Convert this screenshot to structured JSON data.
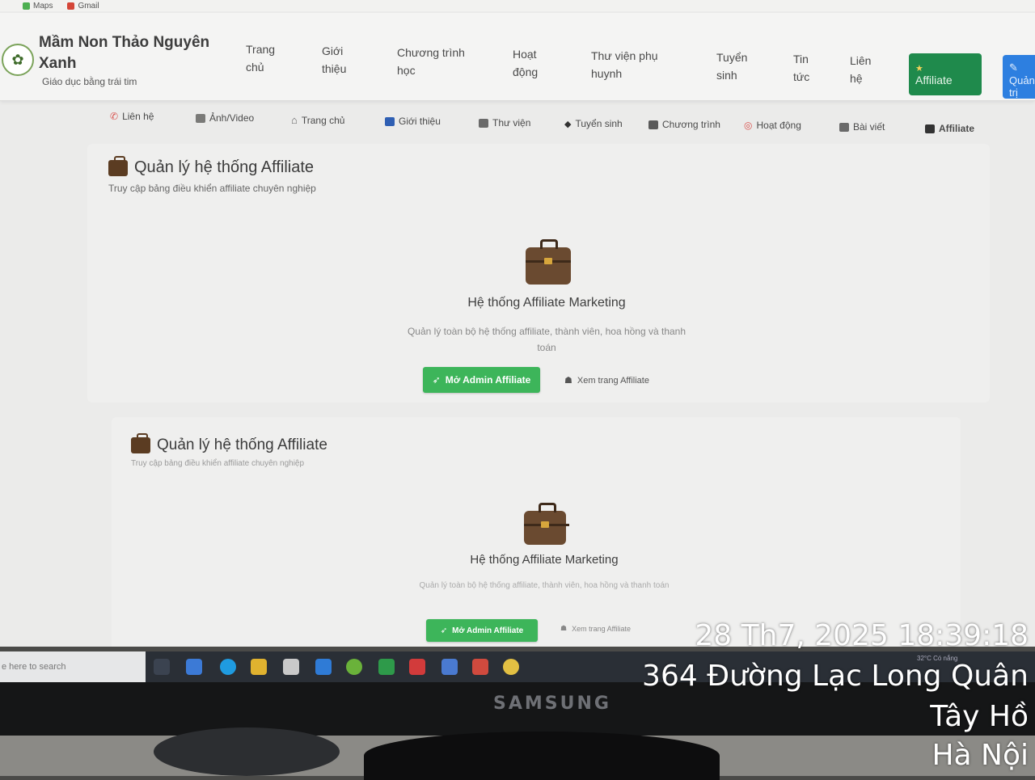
{
  "bookmarks": [
    "Maps",
    "Gmail"
  ],
  "brand": {
    "title": "Mầm Non Thảo Nguyên Xanh",
    "subtitle": "Giáo dục bằng trái tim"
  },
  "nav": {
    "items": [
      {
        "label": "Trang chủ"
      },
      {
        "label": "Giới thiệu"
      },
      {
        "label": "Chương trình học"
      },
      {
        "label": "Hoạt động"
      },
      {
        "label": "Thư viện phụ huynh"
      },
      {
        "label": "Tuyển sinh"
      },
      {
        "label": "Tin tức"
      },
      {
        "label": "Liên hệ"
      }
    ],
    "affiliate_label": "Affiliate",
    "admin_label": "Quản trị"
  },
  "subnav": {
    "items": [
      {
        "label": "Liên hệ",
        "icon": "phone-icon",
        "color": "#d9534f"
      },
      {
        "label": "Ảnh/Video",
        "icon": "image-icon",
        "color": "#777"
      },
      {
        "label": "Trang chủ",
        "icon": "home-icon",
        "color": "#777"
      },
      {
        "label": "Giới thiệu",
        "icon": "info-icon",
        "color": "#2f5fb3"
      },
      {
        "label": "Thư viện",
        "icon": "book-icon",
        "color": "#555"
      },
      {
        "label": "Tuyển sinh",
        "icon": "graduation-cap-icon",
        "color": "#333"
      },
      {
        "label": "Chương trình",
        "icon": "notebook-icon",
        "color": "#555"
      },
      {
        "label": "Hoạt động",
        "icon": "target-icon",
        "color": "#d9534f"
      },
      {
        "label": "Bài viết",
        "icon": "document-icon",
        "color": "#555"
      },
      {
        "label": "Affiliate",
        "icon": "briefcase-icon",
        "color": "#333"
      }
    ]
  },
  "cards": [
    {
      "title": "Quản lý hệ thống Affiliate",
      "subtitle": "Truy cập bảng điều khiển affiliate chuyên nghiệp",
      "hero_title": "Hệ thống Affiliate Marketing",
      "hero_desc": "Quản lý toàn bộ hệ thống affiliate, thành viên, hoa hồng và thanh toán",
      "primary_button": "Mở Admin Affiliate",
      "secondary_link": "Xem trang Affiliate"
    },
    {
      "title": "Quản lý hệ thống Affiliate",
      "subtitle": "Truy cập bảng điều khiển affiliate chuyên nghiệp",
      "hero_title": "Hệ thống Affiliate Marketing",
      "hero_desc": "Quản lý toàn bộ hệ thống affiliate, thành viên, hoa hồng và thanh toán",
      "primary_button": "Mở Admin Affiliate",
      "secondary_link": "Xem trang Affiliate"
    }
  ],
  "taskbar": {
    "search_placeholder": "e here to search",
    "weather": "32°C  Có nắng"
  },
  "monitor_brand": "SAMSUNG",
  "stamp": {
    "datetime": "28 Th7, 2025 18:39:18",
    "address": "364 Đường Lạc Long Quân",
    "district": "Tây Hồ",
    "city": "Hà Nội"
  },
  "colors": {
    "affiliate_button": "#1f8a4c",
    "admin_button": "#2d7fe0",
    "primary_action": "#3db55a"
  }
}
